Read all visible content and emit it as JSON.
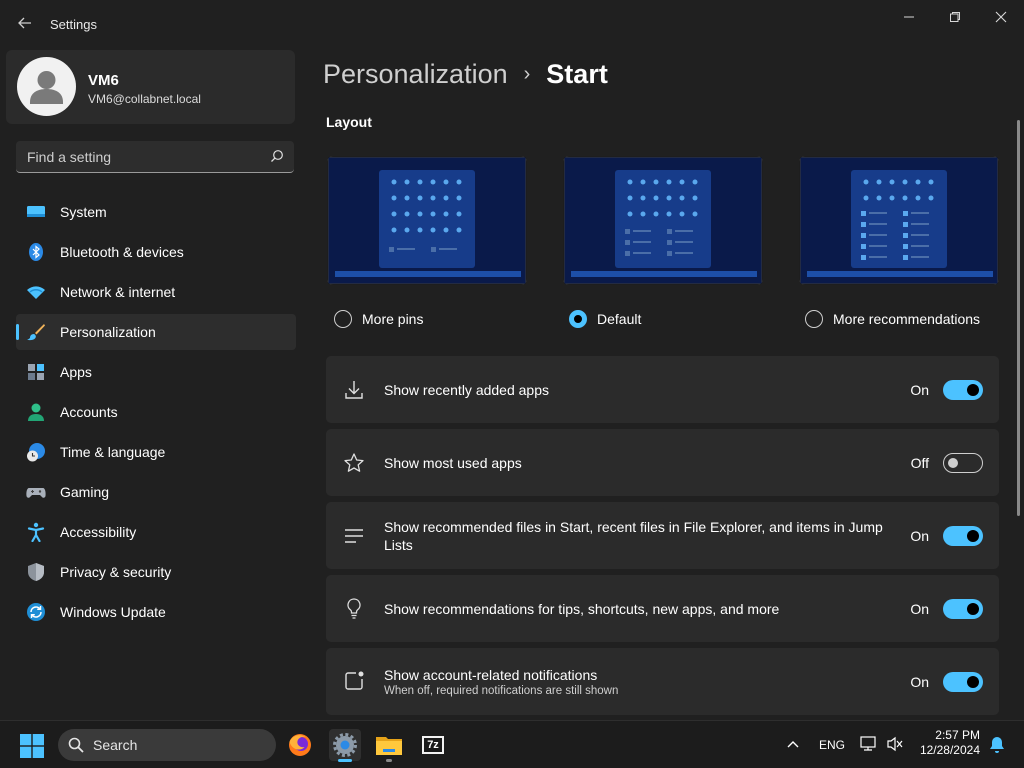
{
  "window": {
    "title": "Settings",
    "controls": [
      "minimize-icon",
      "restore-icon",
      "close-icon"
    ]
  },
  "profile": {
    "name": "VM6",
    "email": "VM6@collabnet.local"
  },
  "search": {
    "placeholder": "Find a setting"
  },
  "sidebar": {
    "items": [
      {
        "label": "System",
        "icon": "system-icon"
      },
      {
        "label": "Bluetooth & devices",
        "icon": "bluetooth-icon"
      },
      {
        "label": "Network & internet",
        "icon": "wifi-icon"
      },
      {
        "label": "Personalization",
        "icon": "brush-icon",
        "selected": true
      },
      {
        "label": "Apps",
        "icon": "apps-icon"
      },
      {
        "label": "Accounts",
        "icon": "person-icon"
      },
      {
        "label": "Time & language",
        "icon": "globe-clock-icon"
      },
      {
        "label": "Gaming",
        "icon": "gamepad-icon"
      },
      {
        "label": "Accessibility",
        "icon": "accessibility-icon"
      },
      {
        "label": "Privacy & security",
        "icon": "shield-icon"
      },
      {
        "label": "Windows Update",
        "icon": "update-icon"
      }
    ]
  },
  "breadcrumb": {
    "parent": "Personalization",
    "separator": "›",
    "current": "Start"
  },
  "layout": {
    "title": "Layout",
    "options": [
      {
        "label": "More pins",
        "selected": false
      },
      {
        "label": "Default",
        "selected": true
      },
      {
        "label": "More recommendations",
        "selected": false
      }
    ]
  },
  "settings": [
    {
      "title": "Show recently added apps",
      "subtitle": "",
      "state": "On",
      "on": true,
      "icon": "download-icon"
    },
    {
      "title": "Show most used apps",
      "subtitle": "",
      "state": "Off",
      "on": false,
      "icon": "star-icon"
    },
    {
      "title": "Show recommended files in Start, recent files in File Explorer, and items in Jump Lists",
      "subtitle": "",
      "state": "On",
      "on": true,
      "icon": "list-icon"
    },
    {
      "title": "Show recommendations for tips, shortcuts, new apps, and more",
      "subtitle": "",
      "state": "On",
      "on": true,
      "icon": "lightbulb-icon"
    },
    {
      "title": "Show account-related notifications",
      "subtitle": "When off, required notifications are still shown",
      "state": "On",
      "on": true,
      "icon": "notification-icon"
    }
  ],
  "taskbar": {
    "search_label": "Search",
    "language": "ENG",
    "time": "2:57 PM",
    "date": "12/28/2024",
    "apps": [
      "firefox-icon",
      "settings-gear-icon",
      "file-explorer-icon",
      "7zip-icon"
    ],
    "seven_zip_label": "7z"
  },
  "colors": {
    "accent": "#4cc2ff",
    "background": "#202020",
    "card": "#2b2b2b"
  }
}
